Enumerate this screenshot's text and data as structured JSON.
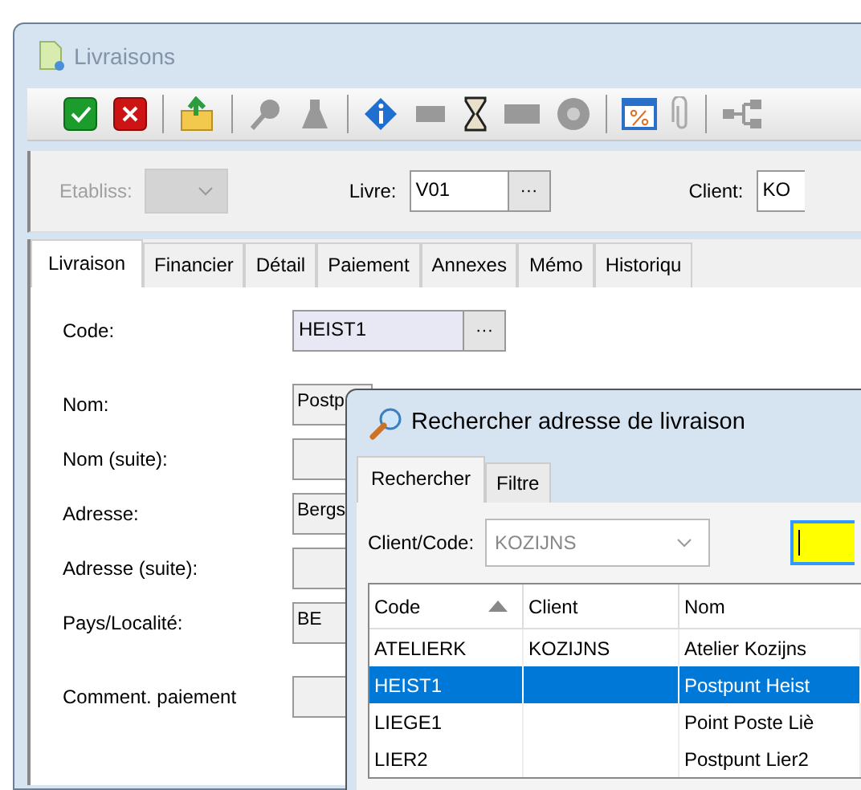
{
  "window": {
    "title": "Livraisons"
  },
  "filter": {
    "etabliss": {
      "label": "Etabliss:",
      "disabled": true
    },
    "livre": {
      "label": "Livre:",
      "value": "V01",
      "button": "···"
    },
    "client": {
      "label": "Client:",
      "value": "KO"
    }
  },
  "tabs": [
    {
      "label": "Livraison",
      "selected": true
    },
    {
      "label": "Financier",
      "selected": false
    },
    {
      "label": "Détail",
      "selected": false
    },
    {
      "label": "Paiement",
      "selected": false
    },
    {
      "label": "Annexes",
      "selected": false
    },
    {
      "label": "Mémo",
      "selected": false
    },
    {
      "label": "Historiqu",
      "selected": false
    }
  ],
  "form": [
    {
      "label": "Code:",
      "value": "HEIST1",
      "kind": "lookup",
      "button": "···"
    },
    {
      "label": "Nom:",
      "value": "Postp",
      "kind": "text"
    },
    {
      "label": "Nom (suite):",
      "kind": "text"
    },
    {
      "label": "Adresse:",
      "value": "Bergs",
      "kind": "text"
    },
    {
      "label": "Adresse (suite):",
      "kind": "text"
    },
    {
      "label": "Pays/Localité:",
      "value": "BE",
      "kind": "text"
    },
    {
      "label": "Comment. paiement",
      "kind": "text"
    }
  ],
  "dialog": {
    "title": "Rechercher adresse de livraison",
    "tabs": [
      {
        "label": "Rechercher",
        "selected": true
      },
      {
        "label": "Filtre",
        "selected": false
      }
    ],
    "client_code": {
      "label": "Client/Code:",
      "value": "KOZIJNS",
      "disabled": true
    },
    "table": {
      "columns": [
        {
          "label": "Code",
          "sorted": true
        },
        {
          "label": "Client",
          "sorted": false
        },
        {
          "label": "Nom",
          "sorted": false
        }
      ],
      "rows": [
        {
          "cells": [
            "ATELIERK",
            "KOZIJNS",
            "Atelier Kozijns"
          ],
          "selected": false
        },
        {
          "cells": [
            "HEIST1",
            "",
            "Postpunt Heist"
          ],
          "selected": true
        },
        {
          "cells": [
            "LIEGE1",
            "",
            "Point Poste Liè"
          ],
          "selected": false
        },
        {
          "cells": [
            "LIER2",
            "",
            "Postpunt Lier2"
          ],
          "selected": false
        }
      ]
    }
  }
}
